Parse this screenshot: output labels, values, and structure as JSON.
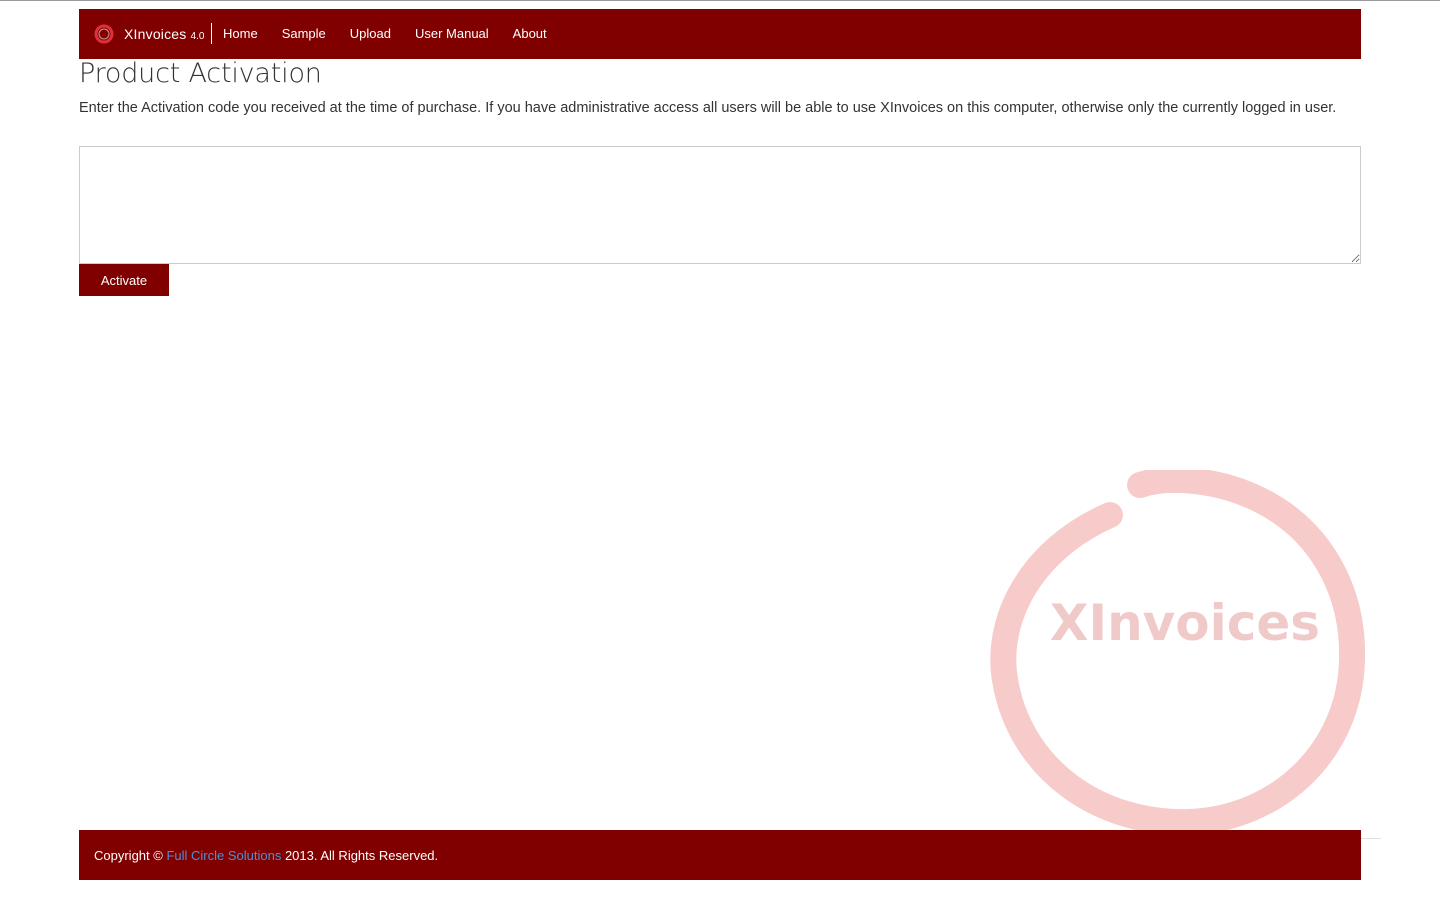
{
  "app": {
    "name": "XInvoices",
    "version": "4.0"
  },
  "nav": {
    "items": [
      {
        "label": "Home"
      },
      {
        "label": "Sample"
      },
      {
        "label": "Upload"
      },
      {
        "label": "User Manual"
      },
      {
        "label": "About"
      }
    ]
  },
  "page": {
    "title": "Product Activation",
    "intro": "Enter the Activation code you received at the time of purchase. If you have administrative access all users will be able to use XInvoices on this computer, otherwise only the currently logged in user.",
    "activation_code": {
      "value": "",
      "placeholder": ""
    },
    "activate_label": "Activate"
  },
  "watermark": {
    "text": "XInvoices"
  },
  "footer": {
    "prefix": "Copyright © ",
    "company": "Full Circle Solutions",
    "suffix": " 2013. All Rights Reserved."
  },
  "colors": {
    "brand": "#800000",
    "link": "#4a90d9"
  }
}
